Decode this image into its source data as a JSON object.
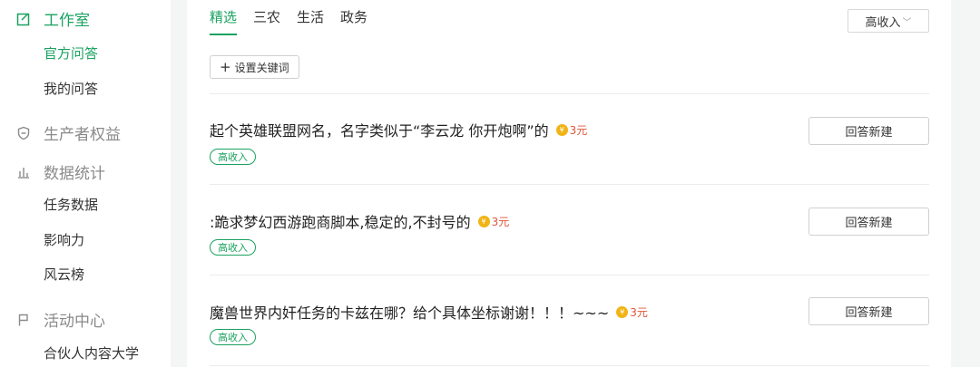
{
  "sidebar": {
    "groups": [
      {
        "label": "工作室",
        "icon": "edit-icon"
      },
      {
        "label": "生产者权益",
        "icon": "shield-icon"
      },
      {
        "label": "数据统计",
        "icon": "bar-chart-icon"
      },
      {
        "label": "活动中心",
        "icon": "flag-icon"
      }
    ],
    "items": [
      "官方问答",
      "我的问答",
      "任务数据",
      "影响力",
      "风云榜",
      "合伙人内容大学"
    ]
  },
  "tabs": [
    "精选",
    "三农",
    "生活",
    "政务"
  ],
  "filter": {
    "label": "高收入",
    "chevron": "﹀"
  },
  "keyword_button": {
    "plus": "+",
    "label": "设置关键词"
  },
  "questions": [
    {
      "title": "起个英雄联盟网名，名字类似于“李云龙 你开炮啊”的",
      "reward": "3元",
      "tag": "高收入",
      "button": "回答新建"
    },
    {
      "title": ":跪求梦幻西游跑商脚本,稳定的,不封号的",
      "reward": "3元",
      "tag": "高收入",
      "button": "回答新建"
    },
    {
      "title": "魔兽世界内奸任务的卡兹在哪？给个具体坐标谢谢！！！~~~",
      "reward": "3元",
      "tag": "高收入",
      "button": "回答新建"
    }
  ],
  "colors": {
    "accent": "#1aa260",
    "reward": "#e0543a",
    "coin": "#f0b416"
  }
}
